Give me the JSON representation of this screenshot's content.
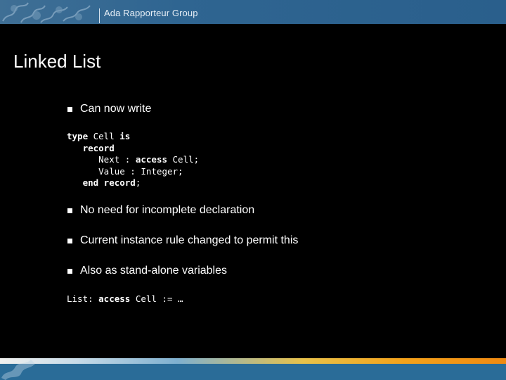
{
  "header": {
    "org": "Ada Rapporteur Group"
  },
  "slide": {
    "title": "Linked List",
    "bullets": [
      "Can now write",
      "No need for incomplete declaration",
      "Current instance rule changed to permit this",
      "Also as stand-alone variables"
    ],
    "code1": [
      [
        {
          "t": "type",
          "k": true
        },
        {
          "t": " Cell "
        },
        {
          "t": "is",
          "k": true
        }
      ],
      [
        {
          "t": "   "
        },
        {
          "t": "record",
          "k": true
        }
      ],
      [
        {
          "t": "      Next : "
        },
        {
          "t": "access",
          "k": true
        },
        {
          "t": " Cell;"
        }
      ],
      [
        {
          "t": "      Value : Integer;"
        }
      ],
      [
        {
          "t": "   "
        },
        {
          "t": "end record",
          "k": true
        },
        {
          "t": ";"
        }
      ]
    ],
    "code2": [
      [
        {
          "t": "List: "
        },
        {
          "t": "access",
          "k": true
        },
        {
          "t": " Cell := …"
        }
      ]
    ]
  },
  "colors": {
    "header_band": "#2f6591",
    "background": "#000000",
    "text": "#ffffff",
    "footer_band": "#2a6c98",
    "footer_accent": "#f08a12"
  },
  "icons": {
    "header_logo": "puzzle-pieces-icon",
    "footer_logo": "puzzle-pieces-icon"
  }
}
